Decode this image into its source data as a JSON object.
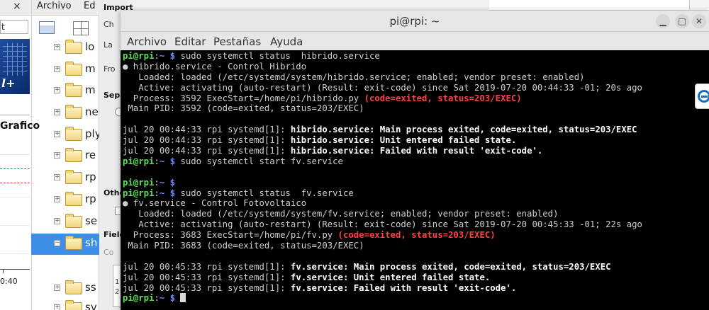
{
  "left_app": {
    "close_glyph": "×",
    "menu": [
      "Archivo",
      "Ed"
    ],
    "address_value": "t",
    "logo_text": "l+",
    "chart_title": "Grafico",
    "chart_time_label": "0:40",
    "tree": [
      "lo",
      "m",
      "m",
      "ne",
      "ply",
      "re",
      "rp",
      "rp",
      "se",
      "sh",
      "ss",
      "sv"
    ]
  },
  "mid_panel": {
    "import_label": "Import",
    "ch_label": "Ch",
    "la_label": "La",
    "fro_label": "Fro",
    "sepa_label": "Sepa",
    "othe_label": "Othe",
    "field_label": "Field",
    "co_label": "Co",
    "table_cells": [
      "1",
      "2"
    ]
  },
  "terminal": {
    "title": "pi@rpi: ~",
    "menus": [
      "Archivo",
      "Editar",
      "Pestañas",
      "Ayuda"
    ],
    "window_buttons": [
      "minimize",
      "maximize",
      "close"
    ],
    "lines": [
      [
        {
          "c": "prompt",
          "t": "pi@rpi"
        },
        {
          "c": "normal",
          "t": ":"
        },
        {
          "c": "path",
          "t": "~ $"
        },
        {
          "c": "normal",
          "t": " sudo systemctl status  hibrido.service"
        }
      ],
      [
        {
          "c": "normal",
          "t": "● hibrido.service - Control Hibrido"
        }
      ],
      [
        {
          "c": "normal",
          "t": "   Loaded: loaded (/etc/systemd/system/hibrido.service; enabled; vendor preset: enabled)"
        }
      ],
      [
        {
          "c": "normal",
          "t": "   Active: activating (auto-restart) (Result: exit-code) since Sat 2019-07-20 00:44:33 -01; 20s ago"
        }
      ],
      [
        {
          "c": "normal",
          "t": "  Process: 3592 ExecStart=/home/pi/hibrido.py "
        },
        {
          "c": "red",
          "t": "(code=exited, status=203/EXEC)"
        }
      ],
      [
        {
          "c": "normal",
          "t": " Main PID: 3592 (code=exited, status=203/EXEC)"
        }
      ],
      [],
      [
        {
          "c": "normal",
          "t": "jul 20 00:44:33 rpi systemd[1]: "
        },
        {
          "c": "bold",
          "t": "hibrido.service: Main process exited, code=exited, status=203/EXEC"
        }
      ],
      [
        {
          "c": "normal",
          "t": "jul 20 00:44:33 rpi systemd[1]: "
        },
        {
          "c": "bold",
          "t": "hibrido.service: Unit entered failed state."
        }
      ],
      [
        {
          "c": "normal",
          "t": "jul 20 00:44:33 rpi systemd[1]: "
        },
        {
          "c": "bold",
          "t": "hibrido.service: Failed with result 'exit-code'."
        }
      ],
      [
        {
          "c": "prompt",
          "t": "pi@rpi"
        },
        {
          "c": "normal",
          "t": ":"
        },
        {
          "c": "path",
          "t": "~ $"
        },
        {
          "c": "normal",
          "t": " sudo systemctl start fv.service"
        }
      ],
      [],
      [
        {
          "c": "prompt",
          "t": "pi@rpi"
        },
        {
          "c": "normal",
          "t": ":"
        },
        {
          "c": "path",
          "t": "~ $"
        }
      ],
      [
        {
          "c": "prompt",
          "t": "pi@rpi"
        },
        {
          "c": "normal",
          "t": ":"
        },
        {
          "c": "path",
          "t": "~ $"
        },
        {
          "c": "normal",
          "t": " sudo systemctl status  fv.service"
        }
      ],
      [
        {
          "c": "normal",
          "t": "● fv.service - Control Fotovoltaico"
        }
      ],
      [
        {
          "c": "normal",
          "t": "   Loaded: loaded (/etc/systemd/system/fv.service; enabled; vendor preset: enabled)"
        }
      ],
      [
        {
          "c": "normal",
          "t": "   Active: activating (auto-restart) (Result: exit-code) since Sat 2019-07-20 00:45:33 -01; 22s ago"
        }
      ],
      [
        {
          "c": "normal",
          "t": "  Process: 3683 ExecStart=/home/pi/fv.py "
        },
        {
          "c": "red",
          "t": "(code=exited, status=203/EXEC)"
        }
      ],
      [
        {
          "c": "normal",
          "t": " Main PID: 3683 (code=exited, status=203/EXEC)"
        }
      ],
      [],
      [
        {
          "c": "normal",
          "t": "jul 20 00:45:33 rpi systemd[1]: "
        },
        {
          "c": "bold",
          "t": "fv.service: Main process exited, code=exited, status=203/EXEC"
        }
      ],
      [
        {
          "c": "normal",
          "t": "jul 20 00:45:33 rpi systemd[1]: "
        },
        {
          "c": "bold",
          "t": "fv.service: Unit entered failed state."
        }
      ],
      [
        {
          "c": "normal",
          "t": "jul 20 00:45:33 rpi systemd[1]: "
        },
        {
          "c": "bold",
          "t": "fv.service: Failed with result 'exit-code'."
        }
      ],
      [
        {
          "c": "prompt",
          "t": "pi@rpi"
        },
        {
          "c": "normal",
          "t": ":"
        },
        {
          "c": "path",
          "t": "~ $"
        },
        {
          "c": "normal",
          "t": " "
        },
        {
          "c": "cursor",
          "t": ""
        }
      ]
    ]
  },
  "colors": {
    "prompt": "#55e055",
    "path": "#6b8cff",
    "error": "#ff4040",
    "selection": "#3d8ee6"
  }
}
